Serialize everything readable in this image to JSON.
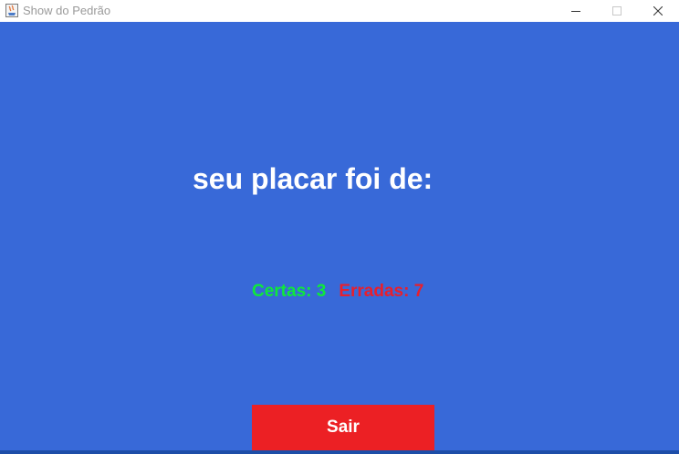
{
  "window": {
    "title": "Show do Pedrão",
    "icons": {
      "app": "java-app-icon",
      "minimize": "minimize-icon",
      "maximize": "maximize-icon",
      "close": "close-icon"
    }
  },
  "results": {
    "heading": "seu placar foi de:",
    "correct_label": "Certas: 3",
    "wrong_label": "Erradas: 7"
  },
  "actions": {
    "exit_label": "Sair"
  },
  "colors": {
    "background": "#3869d8",
    "correct": "#0ee93a",
    "wrong": "#e81f2d",
    "exit_button": "#ec2024",
    "text": "#ffffff"
  }
}
